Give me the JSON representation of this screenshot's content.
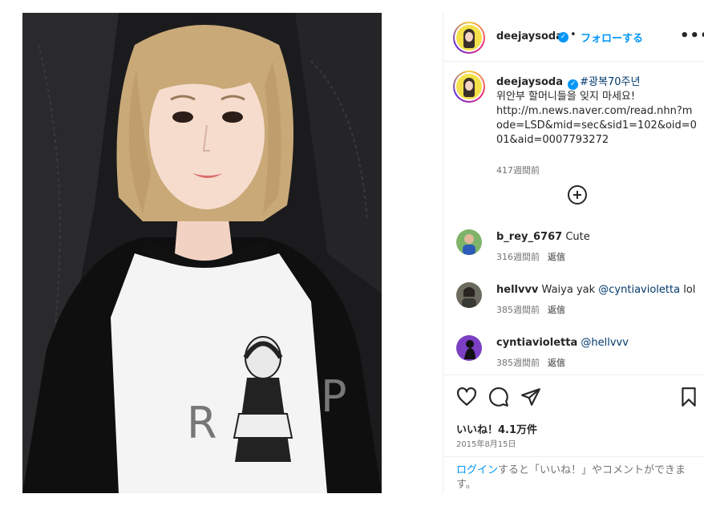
{
  "post": {
    "author": "deejaysoda",
    "verified_symbol": "✓",
    "separator": "•",
    "follow_label": "フォローする",
    "more_label": "•••"
  },
  "caption": {
    "author": "deejaysoda",
    "hashtag": "#광복70주년",
    "line2": "위안부 할머니들을 잊지 마세요!",
    "link": "http://m.news.naver.com/read.nhn?mode=LSD&mid=sec&sid1=102&oid=001&aid=0007793272",
    "time": "417週間前"
  },
  "comments": [
    {
      "user": "b_rey_6767",
      "text": "Cute",
      "mention": "",
      "suffix": "",
      "time": "316週間前",
      "reply": "返信"
    },
    {
      "user": "hellvvv",
      "text": "Waiya yak",
      "mention": "@cyntiavioletta",
      "suffix": "lol",
      "time": "385週間前",
      "reply": "返信"
    },
    {
      "user": "cyntiavioletta",
      "text": "",
      "mention": "@hellvvv",
      "suffix": "",
      "time": "385週間前",
      "reply": "返信"
    }
  ],
  "actions": {
    "likes": "いいね！4.1万件",
    "date": "2015年8月15日",
    "login_link": "ログイン",
    "login_rest": "すると「いいね！」やコメントができます。"
  },
  "icons": [
    "heart-icon",
    "comment-icon",
    "share-icon",
    "bookmark-icon",
    "plus-circle-icon",
    "more-icon"
  ],
  "photo_shirt_letters": [
    "R",
    "P"
  ],
  "colors": {
    "accent": "#0095f6",
    "link": "#00376b",
    "muted": "#737373",
    "text": "#262626"
  }
}
